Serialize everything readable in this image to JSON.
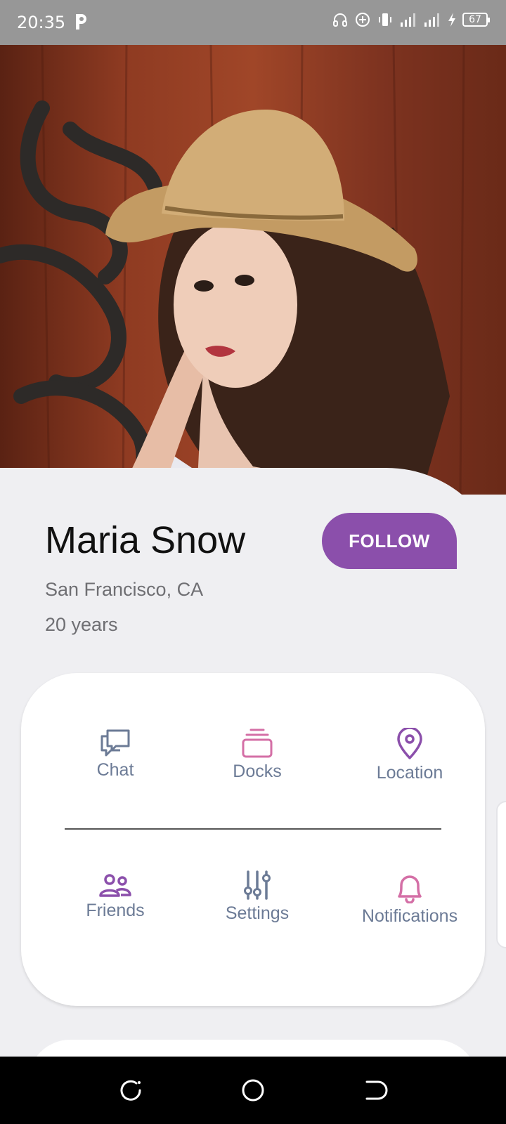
{
  "status_bar": {
    "time": "20:35",
    "battery_level": "67",
    "icons": [
      "p-app-icon",
      "headset-icon",
      "data-saver-icon",
      "vibrate-icon",
      "signal-icon",
      "signal-icon",
      "charging-icon",
      "battery-icon"
    ]
  },
  "profile": {
    "name": "Maria Snow",
    "location": "San Francisco, CA",
    "age": "20 years",
    "follow_label": "FOLLOW"
  },
  "menu": {
    "items": [
      {
        "label": "Chat",
        "icon": "chat-icon"
      },
      {
        "label": "Docks",
        "icon": "stack-icon"
      },
      {
        "label": "Location",
        "icon": "location-pin-icon"
      },
      {
        "label": "Friends",
        "icon": "friends-icon"
      },
      {
        "label": "Settings",
        "icon": "sliders-icon"
      },
      {
        "label": "Notifications",
        "icon": "bell-icon"
      }
    ]
  },
  "colors": {
    "accent": "#8b4fab",
    "pink": "#d46fa6",
    "label": "#6c7b96",
    "background": "#efeff2"
  },
  "nav_bar": {
    "buttons": [
      "recents-icon",
      "home-icon",
      "back-icon"
    ]
  }
}
